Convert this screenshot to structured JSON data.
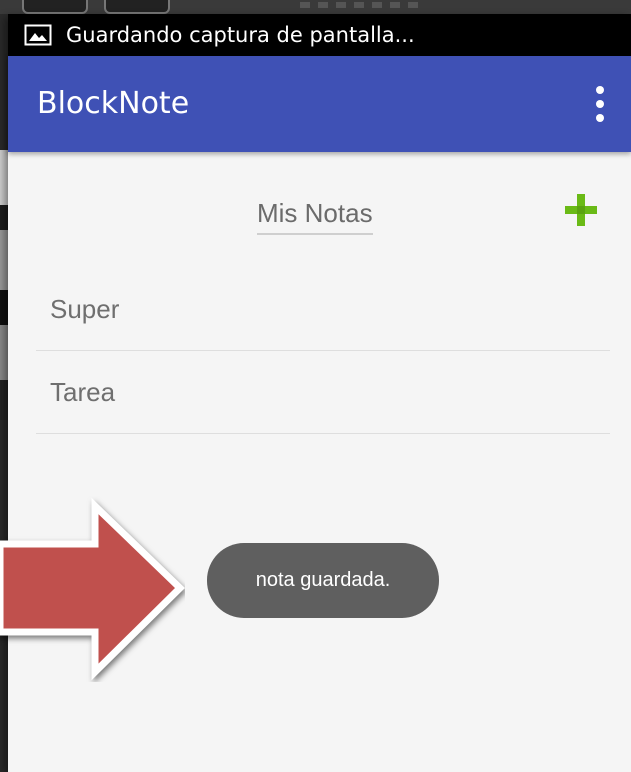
{
  "status_bar": {
    "icon": "image-icon",
    "notification": "Guardando captura de pantalla..."
  },
  "app_bar": {
    "title": "BlockNote",
    "menu_icon": "more-vert-icon",
    "color": "#3f51b5"
  },
  "main": {
    "section_title": "Mis Notas",
    "add_icon": "plus-icon",
    "add_color": "#6aba16",
    "notes": [
      {
        "title": "Super"
      },
      {
        "title": "Tarea"
      }
    ]
  },
  "toast": {
    "message": "nota guardada."
  },
  "annotation": {
    "icon": "arrow-right-icon",
    "color": "#c0504d"
  }
}
